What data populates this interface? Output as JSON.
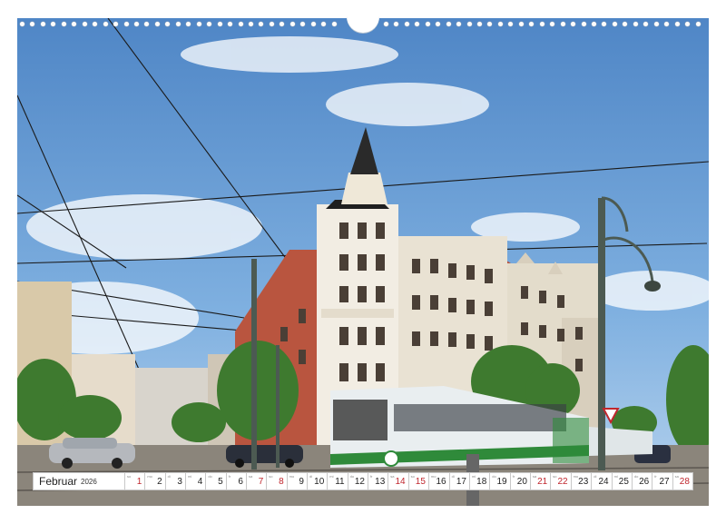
{
  "calendar": {
    "month": "Februar",
    "year": "2026",
    "days": [
      {
        "n": "1",
        "wd": "so",
        "red": true
      },
      {
        "n": "2",
        "wd": "mo",
        "red": false
      },
      {
        "n": "3",
        "wd": "di",
        "red": false
      },
      {
        "n": "4",
        "wd": "mi",
        "red": false
      },
      {
        "n": "5",
        "wd": "do",
        "red": false
      },
      {
        "n": "6",
        "wd": "fr",
        "red": false
      },
      {
        "n": "7",
        "wd": "sa",
        "red": true
      },
      {
        "n": "8",
        "wd": "so",
        "red": true
      },
      {
        "n": "9",
        "wd": "mo",
        "red": false
      },
      {
        "n": "10",
        "wd": "di",
        "red": false
      },
      {
        "n": "11",
        "wd": "mi",
        "red": false
      },
      {
        "n": "12",
        "wd": "do",
        "red": false
      },
      {
        "n": "13",
        "wd": "fr",
        "red": false
      },
      {
        "n": "14",
        "wd": "sa",
        "red": true
      },
      {
        "n": "15",
        "wd": "so",
        "red": true
      },
      {
        "n": "16",
        "wd": "mo",
        "red": false
      },
      {
        "n": "17",
        "wd": "di",
        "red": false
      },
      {
        "n": "18",
        "wd": "mi",
        "red": false
      },
      {
        "n": "19",
        "wd": "do",
        "red": false
      },
      {
        "n": "20",
        "wd": "fr",
        "red": false
      },
      {
        "n": "21",
        "wd": "sa",
        "red": true
      },
      {
        "n": "22",
        "wd": "so",
        "red": true
      },
      {
        "n": "23",
        "wd": "mo",
        "red": false
      },
      {
        "n": "24",
        "wd": "di",
        "red": false
      },
      {
        "n": "25",
        "wd": "mi",
        "red": false
      },
      {
        "n": "26",
        "wd": "do",
        "red": false
      },
      {
        "n": "27",
        "wd": "fr",
        "red": false
      },
      {
        "n": "28",
        "wd": "sa",
        "red": true
      }
    ]
  },
  "colors": {
    "sky": "#6f9fd6",
    "tram_body": "#e9eef0",
    "tram_stripe": "#2f8a3a",
    "building": "#f1ece2",
    "brick": "#a8453a",
    "weekend": "#c0262d"
  }
}
